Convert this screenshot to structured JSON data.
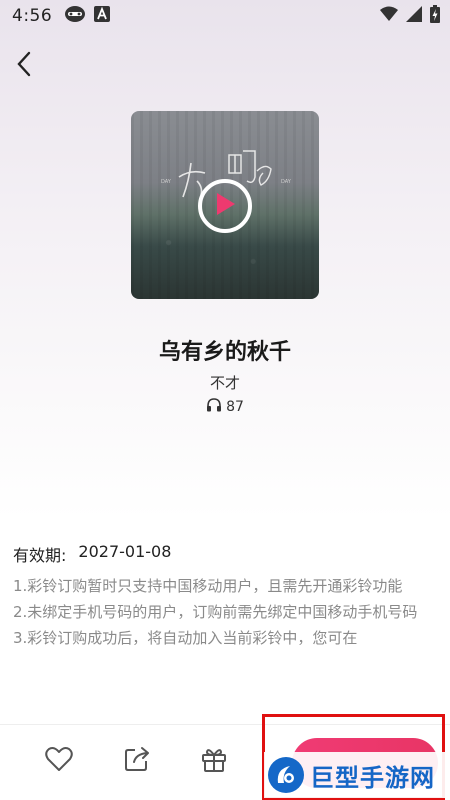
{
  "status_bar": {
    "time": "4:56",
    "left_icons": [
      "headset-icon",
      "a-badge-icon"
    ],
    "right_icons": [
      "wifi-icon",
      "signal-icon",
      "battery-icon"
    ]
  },
  "song": {
    "title": "乌有乡的秋千",
    "artist": "不才",
    "listen_count": "87",
    "cover_text": "可明白"
  },
  "details": {
    "validity_label": "有效期:",
    "validity_date": "2027-01-08",
    "notes": [
      "1.彩铃订购暂时只支持中国移动用户，且需先开通彩铃功能",
      "2.未绑定手机号码的用户，订购前需先绑定中国移动手机号码",
      "3.彩铃订购成功后，将自动加入当前彩铃中，您可在"
    ]
  },
  "bottom_bar": {
    "icons": [
      "heart-icon",
      "share-icon",
      "gift-icon"
    ],
    "accent": "#ee3a6f"
  },
  "watermark": {
    "text": "巨型手游网"
  },
  "colors": {
    "accent": "#ee3a6f",
    "highlight_border": "#e01010",
    "watermark_blue": "#1566c6"
  }
}
